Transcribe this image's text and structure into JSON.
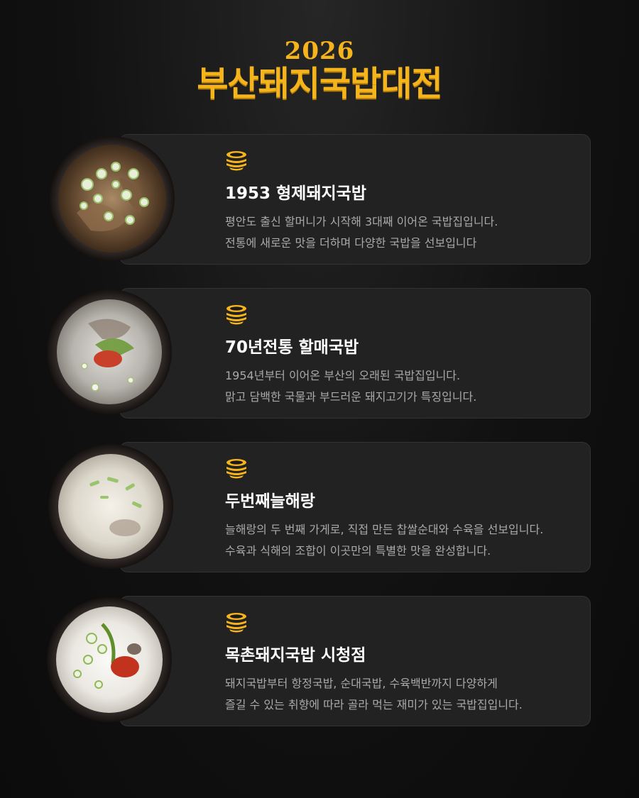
{
  "header": {
    "year": "2026",
    "title": "부산돼지국밥대전"
  },
  "colors": {
    "accent": "#f5b41c",
    "card_bg": "#222222",
    "text": "#ffffff",
    "desc": "#a9a9a9"
  },
  "restaurants": [
    {
      "name": "1953 형제돼지국밥",
      "desc_line1": "평안도 출신 할머니가 시작해 3대째 이어온 국밥집입니다.",
      "desc_line2": "전통에 새로운 맛을 더하며 다양한 국밥을 선보입니다",
      "icon": "gukbap-bowl-icon",
      "image": "dark-broth-gukbap-photo"
    },
    {
      "name": "70년전통 할매국밥",
      "desc_line1": "1954년부터 이어온 부산의 오래된 국밥집입니다.",
      "desc_line2": "맑고 담백한 국물과 부드러운 돼지고기가 특징입니다.",
      "icon": "gukbap-bowl-icon",
      "image": "clear-broth-gukbap-photo"
    },
    {
      "name": "두번째늘해랑",
      "desc_line1": "늘해랑의 두 번째 가게로, 직접 만든 찹쌀순대와 수육을 선보입니다.",
      "desc_line2": "수육과 식해의 조합이 이곳만의 특별한 맛을 완성합니다.",
      "icon": "gukbap-bowl-icon",
      "image": "milky-broth-gukbap-photo"
    },
    {
      "name": "목촌돼지국밥 시청점",
      "desc_line1": "돼지국밥부터 항정국밥, 순대국밥, 수육백반까지 다양하게",
      "desc_line2": "즐길 수 있는 취향에 따라 골라 먹는 재미가 있는 국밥집입니다.",
      "icon": "gukbap-bowl-icon",
      "image": "white-broth-gukbap-photo"
    }
  ]
}
